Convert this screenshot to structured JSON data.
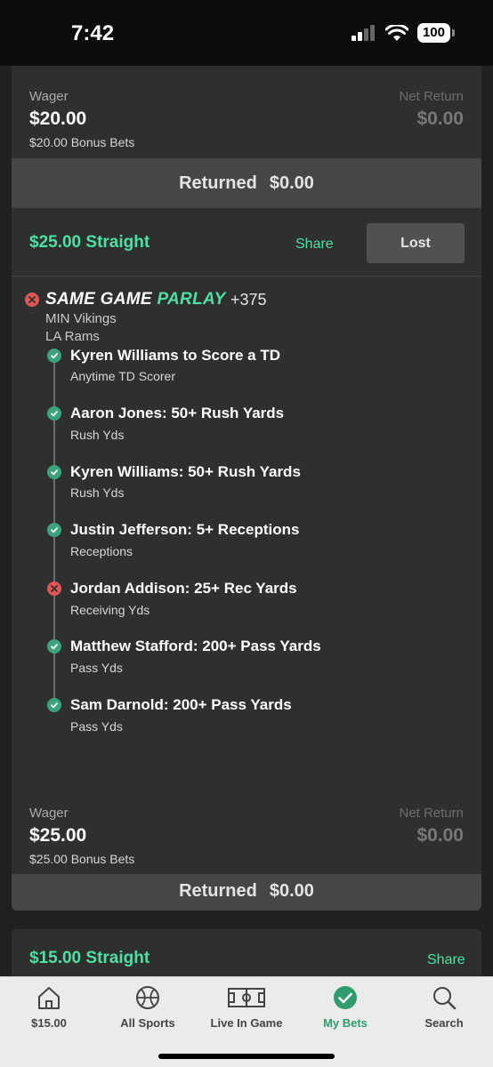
{
  "status": {
    "time": "7:42",
    "battery": "100"
  },
  "card1": {
    "wager_label": "Wager",
    "wager_amount": "$20.00",
    "bonus": "$20.00 Bonus Bets",
    "net_label": "Net Return",
    "net_amount": "$0.00",
    "returned_label": "Returned",
    "returned_amount": "$0.00"
  },
  "card2": {
    "title": "$25.00 Straight",
    "share_label": "Share",
    "status_label": "Lost",
    "parlay_same": "SAME GAME",
    "parlay_word": "PARLAY",
    "odds": "+375",
    "team1": "MIN Vikings",
    "team2": "LA Rams",
    "legs": [
      {
        "title": "Kyren Williams to Score a TD",
        "sub": "Anytime TD Scorer",
        "status": "won"
      },
      {
        "title": "Aaron Jones: 50+ Rush Yards",
        "sub": "Rush Yds",
        "status": "won"
      },
      {
        "title": "Kyren Williams: 50+ Rush Yards",
        "sub": "Rush Yds",
        "status": "won"
      },
      {
        "title": "Justin Jefferson: 5+ Receptions",
        "sub": "Receptions",
        "status": "won"
      },
      {
        "title": "Jordan Addison: 25+ Rec Yards",
        "sub": "Receiving Yds",
        "status": "lost"
      },
      {
        "title": "Matthew Stafford: 200+ Pass Yards",
        "sub": "Pass Yds",
        "status": "won"
      },
      {
        "title": "Sam Darnold: 200+ Pass Yards",
        "sub": "Pass Yds",
        "status": "won"
      }
    ],
    "wager_label": "Wager",
    "wager_amount": "$25.00",
    "bonus": "$25.00 Bonus Bets",
    "net_label": "Net Return",
    "net_amount": "$0.00",
    "returned_label": "Returned",
    "returned_amount": "$0.00"
  },
  "card3": {
    "title": "$15.00 Straight",
    "share_label": "Share"
  },
  "tabs": [
    {
      "label": "$15.00",
      "icon": "home-icon"
    },
    {
      "label": "All Sports",
      "icon": "soccer-ball-icon"
    },
    {
      "label": "Live In Game",
      "icon": "field-icon"
    },
    {
      "label": "My Bets",
      "icon": "check-circle-icon"
    },
    {
      "label": "Search",
      "icon": "search-icon"
    }
  ],
  "colors": {
    "accent": "#4ee0a2",
    "won": "#3da37c",
    "lost": "#e05656",
    "card": "#2e302f",
    "background": "#1f2120"
  }
}
